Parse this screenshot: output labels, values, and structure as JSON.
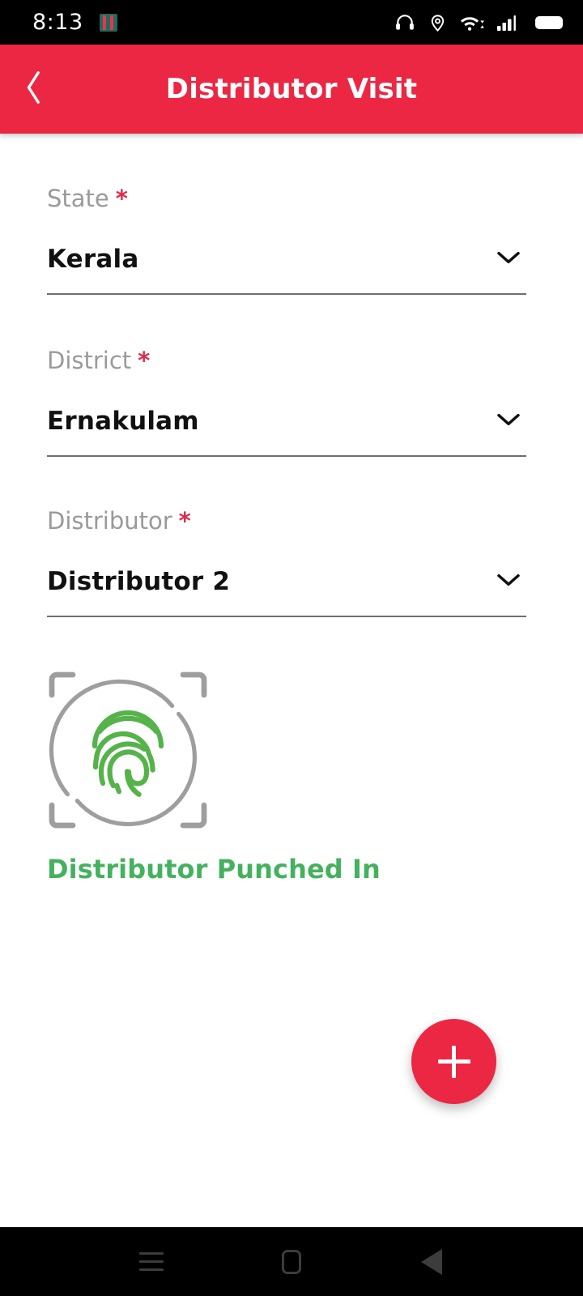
{
  "status_bar": {
    "time": "8:13",
    "app_icon_name": "notification-app-icon",
    "icons": [
      "headphones-icon",
      "location-pin-icon",
      "wifi-icon",
      "signal-bars-icon",
      "battery-icon"
    ]
  },
  "header": {
    "back_icon": "back-chevron-icon",
    "title": "Distributor Visit",
    "background_color": "#ec2743"
  },
  "form": {
    "required_marker": "*",
    "fields": [
      {
        "label": "State",
        "value": "Kerala",
        "dropdown_icon": "chevron-down-icon"
      },
      {
        "label": "District",
        "value": "Ernakulam",
        "dropdown_icon": "chevron-down-icon"
      },
      {
        "label": "Distributor",
        "value": "Distributor 2",
        "dropdown_icon": "chevron-down-icon"
      }
    ]
  },
  "biometric": {
    "scanner_icon": "fingerprint-scanner-icon",
    "fingerprint_color": "#55b34a",
    "frame_color": "#9e9e9e",
    "status_text": "Distributor Punched In",
    "status_color": "#45b15f"
  },
  "fab": {
    "icon": "plus-icon",
    "label": "+",
    "color": "#ec2743"
  },
  "nav_bar": {
    "items": [
      {
        "name": "recents",
        "icon": "menu-lines-icon"
      },
      {
        "name": "home",
        "icon": "home-square-icon"
      },
      {
        "name": "back",
        "icon": "back-triangle-icon"
      }
    ]
  }
}
